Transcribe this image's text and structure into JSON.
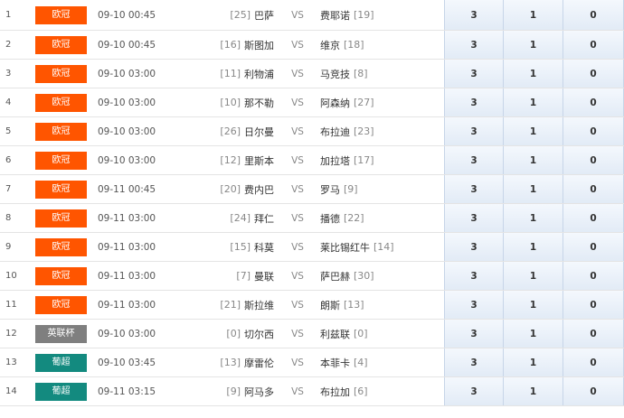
{
  "colors": {
    "ucl": "#ff5500",
    "efl_cup": "#7f7f7f",
    "primeira_liga": "#138a7f"
  },
  "rows": [
    {
      "index": "1",
      "league": "欧冠",
      "league_color": "#ff5500",
      "time": "09-10 00:45",
      "home_rank": "[25]",
      "home": "巴萨",
      "vs": "VS",
      "away": "费耶诺",
      "away_rank": "[19]",
      "odds": [
        "3",
        "1",
        "0"
      ]
    },
    {
      "index": "2",
      "league": "欧冠",
      "league_color": "#ff5500",
      "time": "09-10 00:45",
      "home_rank": "[16]",
      "home": "斯图加",
      "vs": "VS",
      "away": "维京",
      "away_rank": "[18]",
      "odds": [
        "3",
        "1",
        "0"
      ]
    },
    {
      "index": "3",
      "league": "欧冠",
      "league_color": "#ff5500",
      "time": "09-10 03:00",
      "home_rank": "[11]",
      "home": "利物浦",
      "vs": "VS",
      "away": "马竞技",
      "away_rank": "[8]",
      "odds": [
        "3",
        "1",
        "0"
      ]
    },
    {
      "index": "4",
      "league": "欧冠",
      "league_color": "#ff5500",
      "time": "09-10 03:00",
      "home_rank": "[10]",
      "home": "那不勒",
      "vs": "VS",
      "away": "阿森纳",
      "away_rank": "[27]",
      "odds": [
        "3",
        "1",
        "0"
      ]
    },
    {
      "index": "5",
      "league": "欧冠",
      "league_color": "#ff5500",
      "time": "09-10 03:00",
      "home_rank": "[26]",
      "home": "日尔曼",
      "vs": "VS",
      "away": "布拉迪",
      "away_rank": "[23]",
      "odds": [
        "3",
        "1",
        "0"
      ]
    },
    {
      "index": "6",
      "league": "欧冠",
      "league_color": "#ff5500",
      "time": "09-10 03:00",
      "home_rank": "[12]",
      "home": "里斯本",
      "vs": "VS",
      "away": "加拉塔",
      "away_rank": "[17]",
      "odds": [
        "3",
        "1",
        "0"
      ]
    },
    {
      "index": "7",
      "league": "欧冠",
      "league_color": "#ff5500",
      "time": "09-11 00:45",
      "home_rank": "[20]",
      "home": "费内巴",
      "vs": "VS",
      "away": "罗马",
      "away_rank": "[9]",
      "odds": [
        "3",
        "1",
        "0"
      ]
    },
    {
      "index": "8",
      "league": "欧冠",
      "league_color": "#ff5500",
      "time": "09-11 03:00",
      "home_rank": "[24]",
      "home": "拜仁",
      "vs": "VS",
      "away": "播德",
      "away_rank": "[22]",
      "odds": [
        "3",
        "1",
        "0"
      ]
    },
    {
      "index": "9",
      "league": "欧冠",
      "league_color": "#ff5500",
      "time": "09-11 03:00",
      "home_rank": "[15]",
      "home": "科莫",
      "vs": "VS",
      "away": "莱比锡红牛",
      "away_rank": "[14]",
      "odds": [
        "3",
        "1",
        "0"
      ]
    },
    {
      "index": "10",
      "league": "欧冠",
      "league_color": "#ff5500",
      "time": "09-11 03:00",
      "home_rank": "[7]",
      "home": "曼联",
      "vs": "VS",
      "away": "萨巴赫",
      "away_rank": "[30]",
      "odds": [
        "3",
        "1",
        "0"
      ]
    },
    {
      "index": "11",
      "league": "欧冠",
      "league_color": "#ff5500",
      "time": "09-11 03:00",
      "home_rank": "[21]",
      "home": "斯拉维",
      "vs": "VS",
      "away": "朗斯",
      "away_rank": "[13]",
      "odds": [
        "3",
        "1",
        "0"
      ]
    },
    {
      "index": "12",
      "league": "英联杯",
      "league_color": "#7f7f7f",
      "time": "09-10 03:00",
      "home_rank": "[0]",
      "home": "切尔西",
      "vs": "VS",
      "away": "利兹联",
      "away_rank": "[0]",
      "odds": [
        "3",
        "1",
        "0"
      ]
    },
    {
      "index": "13",
      "league": "葡超",
      "league_color": "#138a7f",
      "time": "09-10 03:45",
      "home_rank": "[13]",
      "home": "摩雷伦",
      "vs": "VS",
      "away": "本菲卡",
      "away_rank": "[4]",
      "odds": [
        "3",
        "1",
        "0"
      ]
    },
    {
      "index": "14",
      "league": "葡超",
      "league_color": "#138a7f",
      "time": "09-11 03:15",
      "home_rank": "[9]",
      "home": "阿马多",
      "vs": "VS",
      "away": "布拉加",
      "away_rank": "[6]",
      "odds": [
        "3",
        "1",
        "0"
      ]
    }
  ]
}
